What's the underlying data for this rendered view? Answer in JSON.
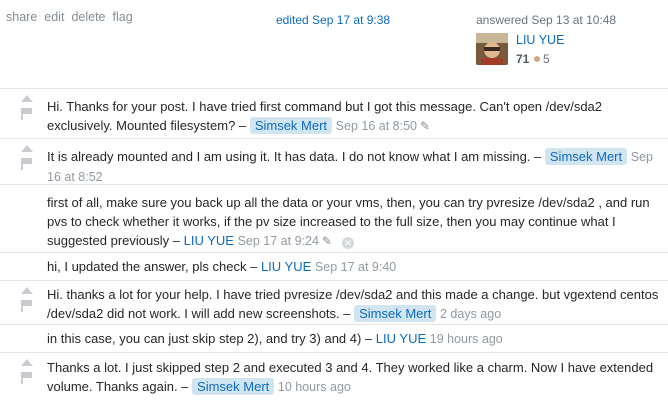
{
  "post_menu": {
    "share": "share",
    "edit": "edit",
    "delete": "delete",
    "flag": "flag"
  },
  "edited": "edited Sep 17 at 9:38",
  "answered": "answered Sep 13 at 10:48",
  "user": {
    "name": "LIU YUE",
    "reputation": "71",
    "bronze": "5"
  },
  "comments": [
    {
      "text": "Hi. Thanks for your post. I have tried first command but I got this message. Can't open /dev/sda2 exclusively. Mounted filesystem? –",
      "user": "Simsek Mert",
      "date": "Sep 16 at 8:50"
    },
    {
      "text": "It is already mounted and I am using it. It has data. I do not know what I am missing. –",
      "user": "Simsek Mert",
      "date": "Sep 16 at 8:52"
    },
    {
      "text": "first of all, make sure you back up all the data or your vms, then, you can try pvresize /dev/sda2 , and run pvs to check whether it works, if the pv size increased to the full size, then you may continue what I suggested previously –",
      "user": "LIU YUE",
      "date": "Sep 17 at 9:24"
    },
    {
      "text": "hi, I updated the answer, pls check –",
      "user": "LIU YUE",
      "date": "Sep 17 at 9:40"
    },
    {
      "text": "Hi. thanks a lot for your help. I have tried pvresize /dev/sda2 and this made a change. but vgextend centos /dev/sda2 did not work. I will add new screenshots. –",
      "user": "Simsek Mert",
      "date": "2 days ago"
    },
    {
      "text": "in this case, you can just skip step 2), and try 3) and 4) –",
      "user": "LIU YUE",
      "date": "19 hours ago"
    },
    {
      "text": "Thanks a lot. I just skipped step 2 and executed 3 and 4. They worked like a charm. Now I have extended volume. Thanks again. –",
      "user": "Simsek Mert",
      "date": "10 hours ago"
    }
  ]
}
